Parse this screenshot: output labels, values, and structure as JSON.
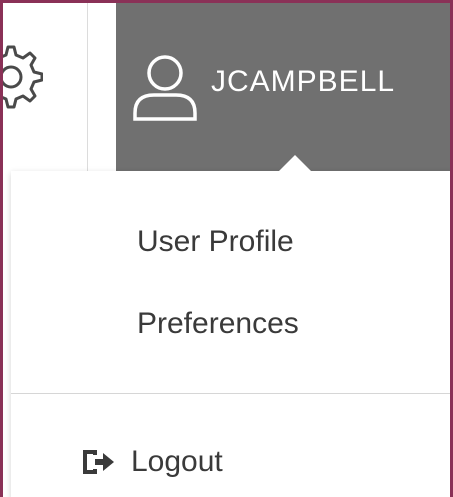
{
  "header": {
    "username": "JCAMPBELL"
  },
  "menu": {
    "items": [
      {
        "label": "User Profile"
      },
      {
        "label": "Preferences"
      }
    ],
    "logout_label": "Logout"
  },
  "icons": {
    "settings": "gear-icon",
    "user": "user-icon",
    "logout": "logout-icon"
  },
  "colors": {
    "frame_border": "#8a3157",
    "user_bar": "#707070",
    "text": "#3a3a3a"
  }
}
